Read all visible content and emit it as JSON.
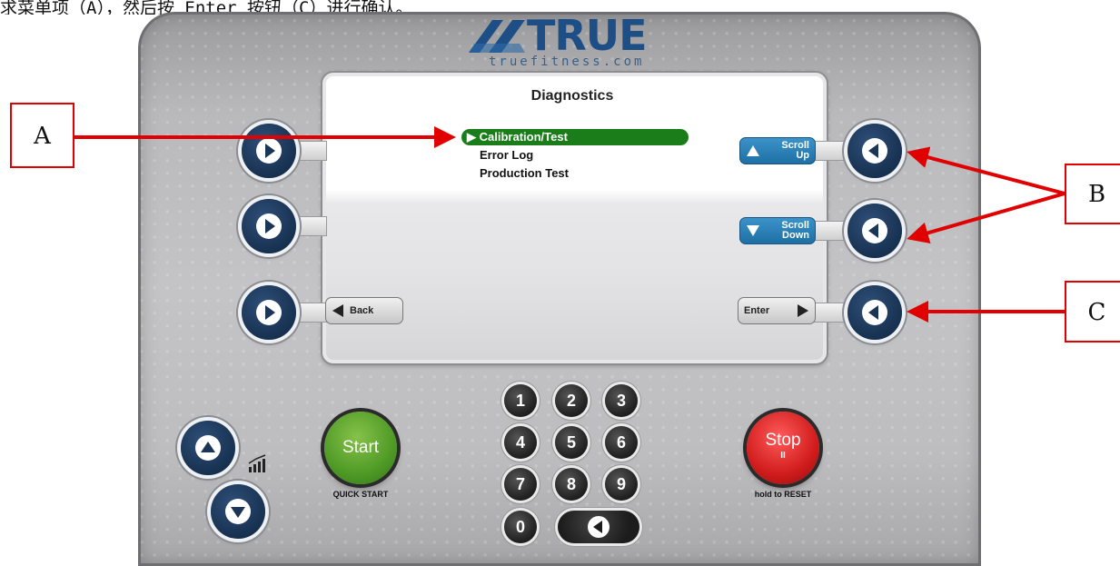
{
  "caption": "求菜单项（A），然后按 Enter 按钮（C）进行确认。",
  "brand": {
    "name": "TRUE",
    "url": "truefitness.com"
  },
  "screen": {
    "title": "Diagnostics",
    "menu": [
      {
        "label": "Calibration/Test",
        "selected": true,
        "marker": "▶"
      },
      {
        "label": "Error Log",
        "selected": false
      },
      {
        "label": "Production Test",
        "selected": false
      }
    ],
    "softkeys": {
      "scroll_up": {
        "line1": "Scroll",
        "line2": "Up"
      },
      "scroll_down": {
        "line1": "Scroll",
        "line2": "Down"
      },
      "back": "Back",
      "enter": "Enter"
    }
  },
  "keypad": [
    "1",
    "2",
    "3",
    "4",
    "5",
    "6",
    "7",
    "8",
    "9",
    "0"
  ],
  "buttons": {
    "start": "Start",
    "start_sub": "QUICK START",
    "stop": "Stop",
    "stop_pause": "II",
    "stop_sub": "hold to RESET"
  },
  "callouts": {
    "a": "A",
    "b": "B",
    "c": "C"
  },
  "colors": {
    "callout": "#e00000",
    "selected": "#1a7d1a",
    "button_navy": "#1a3556",
    "softkey_blue": "#1e6fa4"
  }
}
